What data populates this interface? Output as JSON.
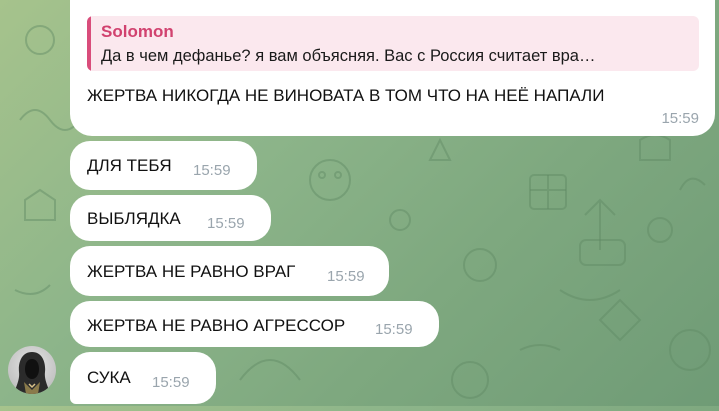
{
  "messages": [
    {
      "reply": {
        "author": "Solomon",
        "quote": "Да в чем дефанье? я вам объясняя. Вас с Россия считает вра…"
      },
      "text": "ЖЕРТВА НИКОГДА НЕ ВИНОВАТА В ТОМ ЧТО НА НЕЁ НАПАЛИ",
      "time": "15:59"
    },
    {
      "text": "ДЛЯ ТЕБЯ",
      "time": "15:59"
    },
    {
      "text": "ВЫБЛЯДКА",
      "time": "15:59"
    },
    {
      "text": "ЖЕРТВА НЕ РАВНО ВРАГ",
      "time": "15:59"
    },
    {
      "text": "ЖЕРТВА НЕ РАВНО АГРЕССОР",
      "time": "15:59"
    },
    {
      "text": "СУКА",
      "time": "15:59"
    }
  ],
  "colors": {
    "reply_accent": "#d94d7b",
    "reply_bg": "#fbe8ee",
    "time": "#9aa5ad"
  }
}
